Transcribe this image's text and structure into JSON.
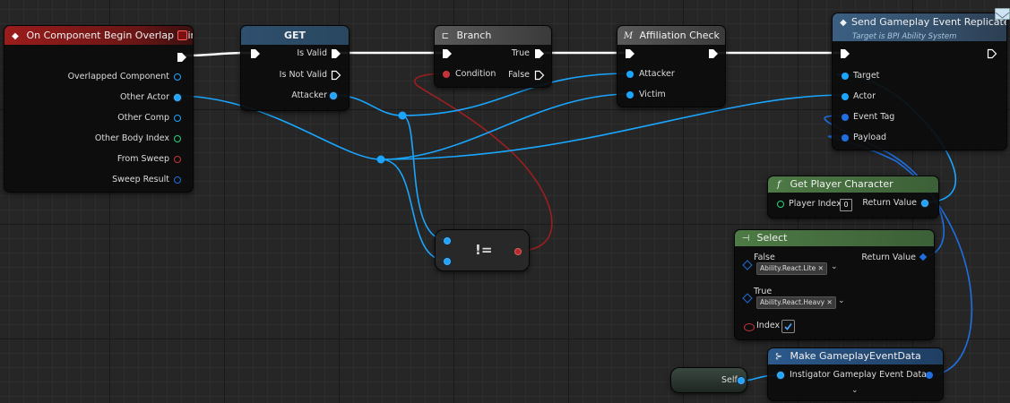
{
  "nodes": {
    "overlap": {
      "title": "On Component Begin Overlap (Ring)",
      "pins": [
        "Overlapped Component",
        "Other Actor",
        "Other Comp",
        "Other Body Index",
        "From Sweep",
        "Sweep Result"
      ]
    },
    "get": {
      "title": "GET",
      "pins": {
        "is_valid": "Is Valid",
        "is_not_valid": "Is Not Valid",
        "attacker": "Attacker"
      }
    },
    "branch": {
      "title": "Branch",
      "pins": {
        "condition": "Condition",
        "true": "True",
        "false": "False"
      }
    },
    "affiliation": {
      "title": "Affiliation Check",
      "pins": {
        "attacker": "Attacker",
        "victim": "Victim"
      }
    },
    "send_event": {
      "title": "Send Gameplay Event Replicated",
      "subtitle": "Target is BPI Ability System",
      "pins": {
        "target": "Target",
        "actor": "Actor",
        "event_tag": "Event Tag",
        "payload": "Payload"
      }
    },
    "not_equal": {
      "label": "!="
    },
    "get_player": {
      "title": "Get Player Character",
      "pins": {
        "player_index": "Player Index",
        "player_index_value": "0",
        "return_value": "Return Value"
      }
    },
    "select": {
      "title": "Select",
      "pins": {
        "false": "False",
        "false_value": "Ability.React.Lite",
        "true": "True",
        "true_value": "Ability.React.Heavy",
        "index": "Index",
        "return_value": "Return Value"
      }
    },
    "make_event_data": {
      "title": "Make GameplayEventData",
      "pins": {
        "instigator": "Instigator",
        "gameplay_event_data": "Gameplay Event Data"
      }
    },
    "self": {
      "label": "Self"
    }
  },
  "colors": {
    "event_header": "#9b1c1c",
    "function_header": "#2f5a82",
    "macro_header": "#4a4a4a",
    "pure_header": "#3f6a3a",
    "object_wire": "#1aa6ff",
    "bool_wire": "#b52a2a",
    "exec_wire": "#ffffff"
  },
  "icons": [
    "diamond-icon",
    "close-icon",
    "branch-icon",
    "macro-icon",
    "function-icon",
    "select-icon",
    "struct-icon",
    "mail-icon",
    "checkmark-icon",
    "chevron-down-icon",
    "exec-pin-icon"
  ]
}
